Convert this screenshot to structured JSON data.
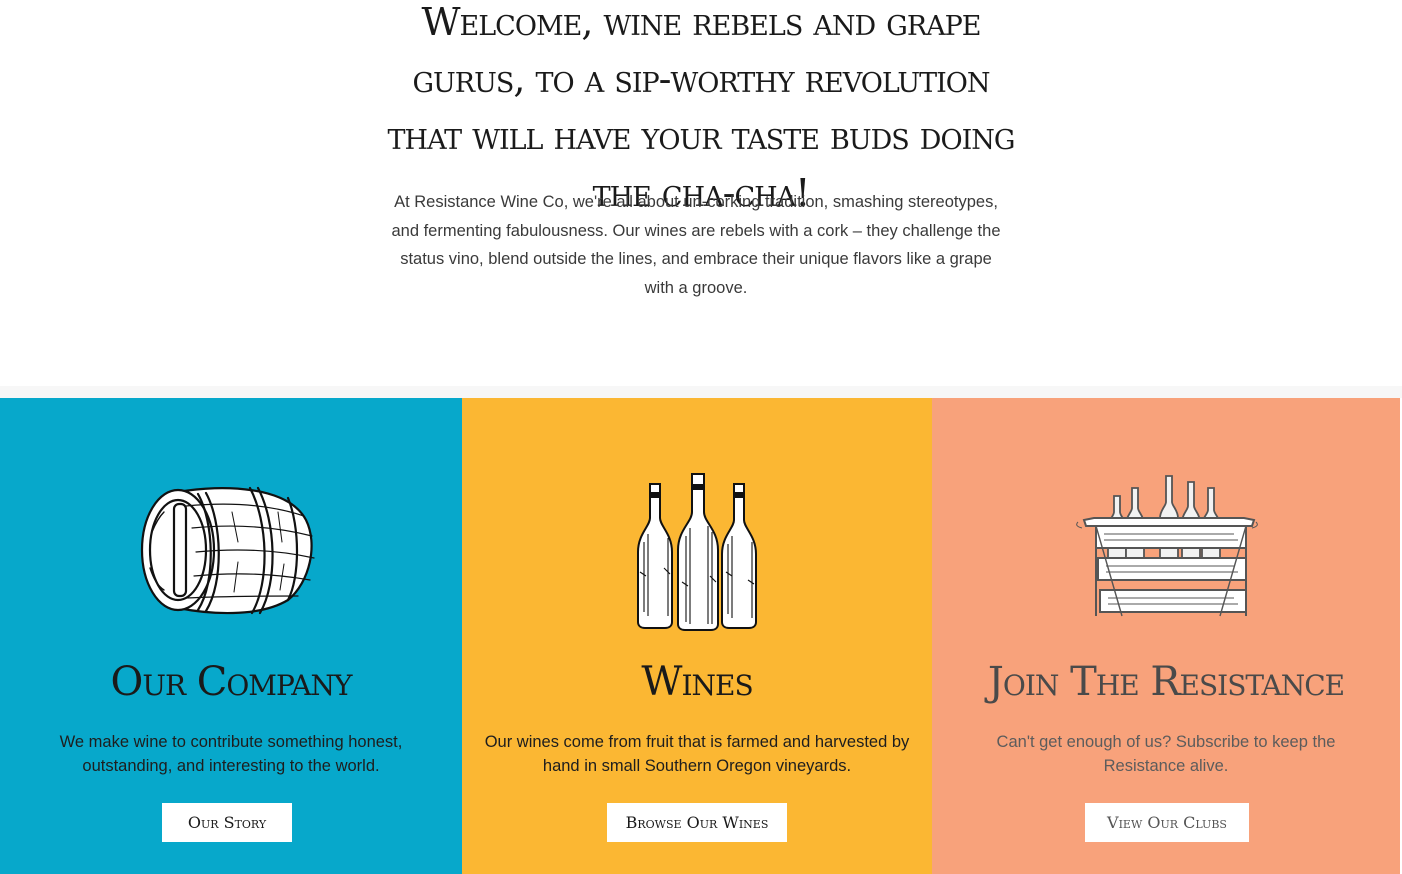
{
  "intro": {
    "headline": "Welcome, wine rebels and grape gurus, to a sip-worthy revolution that will have your taste buds doing the cha-cha!",
    "text": "At Resistance Wine Co, we're all about un-corking tradition, smashing stereotypes, and fermenting fabulousness. Our wines are rebels with a cork – they challenge the status vino, blend outside the lines, and embrace their unique flavors like a grape with a groove."
  },
  "panels": [
    {
      "title": "Our Company",
      "text": "We make wine to contribute something honest, outstanding, and interesting to the world.",
      "button": "Our Story",
      "icon": "wine-barrel-icon",
      "color": "#07a8cb"
    },
    {
      "title": "Wines",
      "text": "Our wines come from fruit that is farmed and harvested by hand in small Southern Oregon vineyards.",
      "button": "Browse Our Wines",
      "icon": "wine-bottles-icon",
      "color": "#fbb733"
    },
    {
      "title": "Join The Resistance",
      "text": "Can't get enough of us? Subscribe to keep the Resistance alive.",
      "button": "View Our Clubs",
      "icon": "wine-crate-icon",
      "color": "#f8a27b"
    }
  ]
}
